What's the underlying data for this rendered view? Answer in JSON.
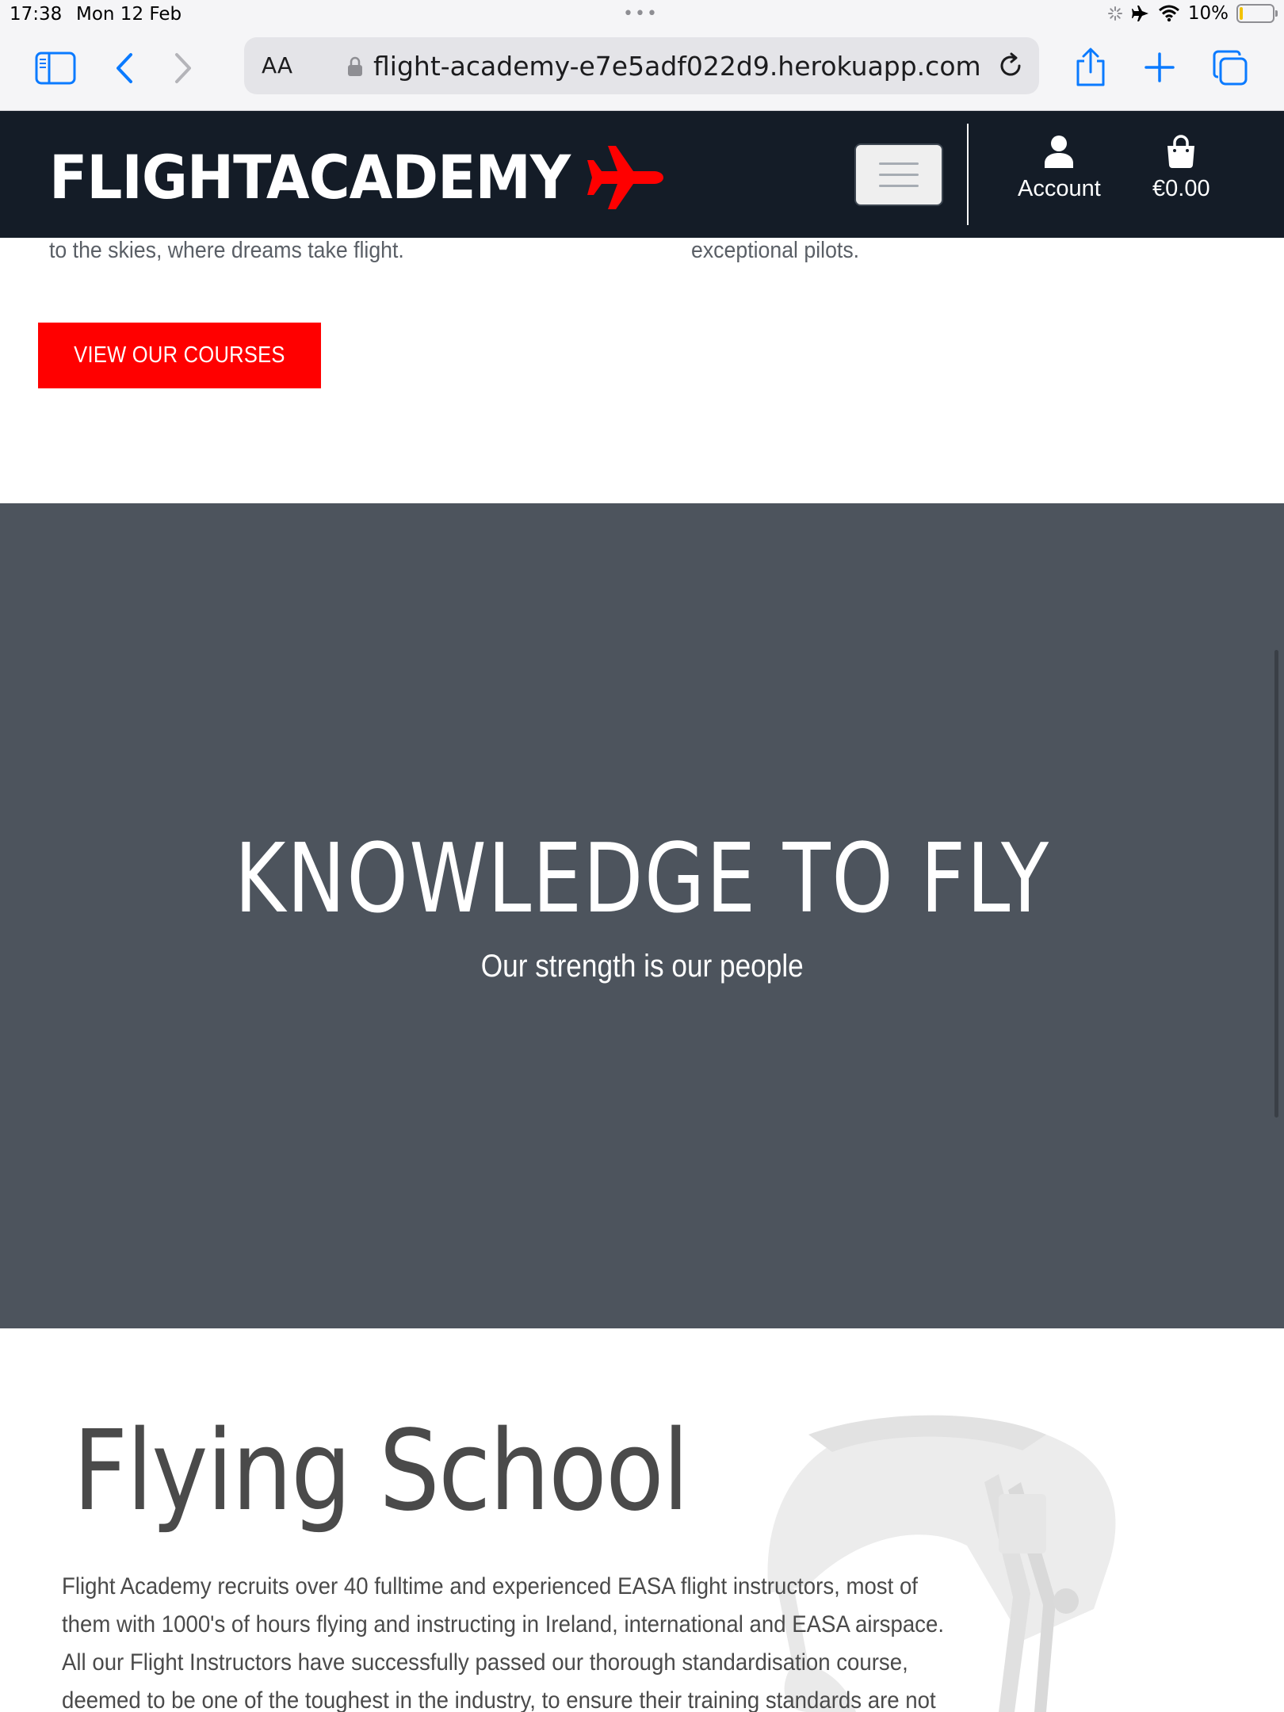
{
  "status_bar": {
    "time": "17:38",
    "date": "Mon 12 Feb",
    "battery": "10%",
    "battery_level": 0.1
  },
  "browser": {
    "aa_label": "AA",
    "url": "flight-academy-e7e5adf022d9.herokuapp.com",
    "accent_color": "#0a7aff"
  },
  "header": {
    "logo_text": "FLIGHTACADEMY",
    "account_label": "Account",
    "cart_total": "€0.00",
    "background_color": "#141c27",
    "brand_color": "#ff0000"
  },
  "intro": {
    "left_text": "to the skies, where dreams take flight.",
    "right_text": "exceptional pilots.",
    "cta_label": "VIEW OUR COURSES"
  },
  "banner": {
    "title": "KNOWLEDGE TO FLY",
    "subtitle": "Our strength is our people",
    "background_color": "#4d545d"
  },
  "flying_school": {
    "title": "Flying School",
    "lines": [
      "Flight Academy recruits over 40 fulltime and experienced EASA flight instructors, most of",
      "them with 1000's of hours flying and instructing in Ireland, international and EASA airspace.",
      "All our Flight Instructors have successfully passed our thorough standardisation course,",
      "deemed to be one of the toughest in the industry, to ensure their training standards are not"
    ]
  }
}
